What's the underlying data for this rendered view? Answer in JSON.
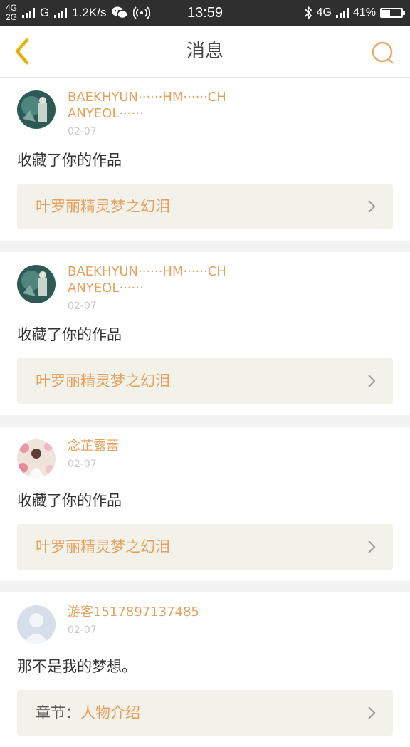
{
  "status_bar": {
    "net_top": "4G",
    "net_bottom": "2G",
    "carrier2": "G",
    "speed": "1.2K/s",
    "time": "13:59",
    "net_right": "4G",
    "battery_percent_text": "41%",
    "battery_level": 0.41,
    "icons": [
      "wechat-icon",
      "hotspot-icon",
      "bluetooth-icon"
    ]
  },
  "header": {
    "back_icon": "chevron-left-icon",
    "title": "消息",
    "search_icon": "search-icon"
  },
  "colors": {
    "accent": "#e6a05c",
    "back_arrow": "#f1c21b",
    "card_bg": "#f3f2ea",
    "separator": "#f2f2f2"
  },
  "messages": [
    {
      "name": "BAEKHYUN······HM······CHANYEOL······",
      "date": "02-07",
      "text": "收藏了你的作品",
      "work_label": "",
      "work_title": "叶罗丽精灵梦之幻泪",
      "avatar": "green-photo-avatar"
    },
    {
      "name": "BAEKHYUN······HM······CHANYEOL······",
      "date": "02-07",
      "text": "收藏了你的作品",
      "work_label": "",
      "work_title": "叶罗丽精灵梦之幻泪",
      "avatar": "green-photo-avatar"
    },
    {
      "name": "念芷露蕾",
      "date": "02-07",
      "text": "收藏了你的作品",
      "work_label": "",
      "work_title": "叶罗丽精灵梦之幻泪",
      "avatar": "flower-photo-avatar"
    },
    {
      "name": "游客1517897137485",
      "date": "02-07",
      "text": "那不是我的梦想。",
      "work_label": "章节：",
      "work_title": "人物介绍",
      "avatar": "default-user-avatar"
    }
  ]
}
